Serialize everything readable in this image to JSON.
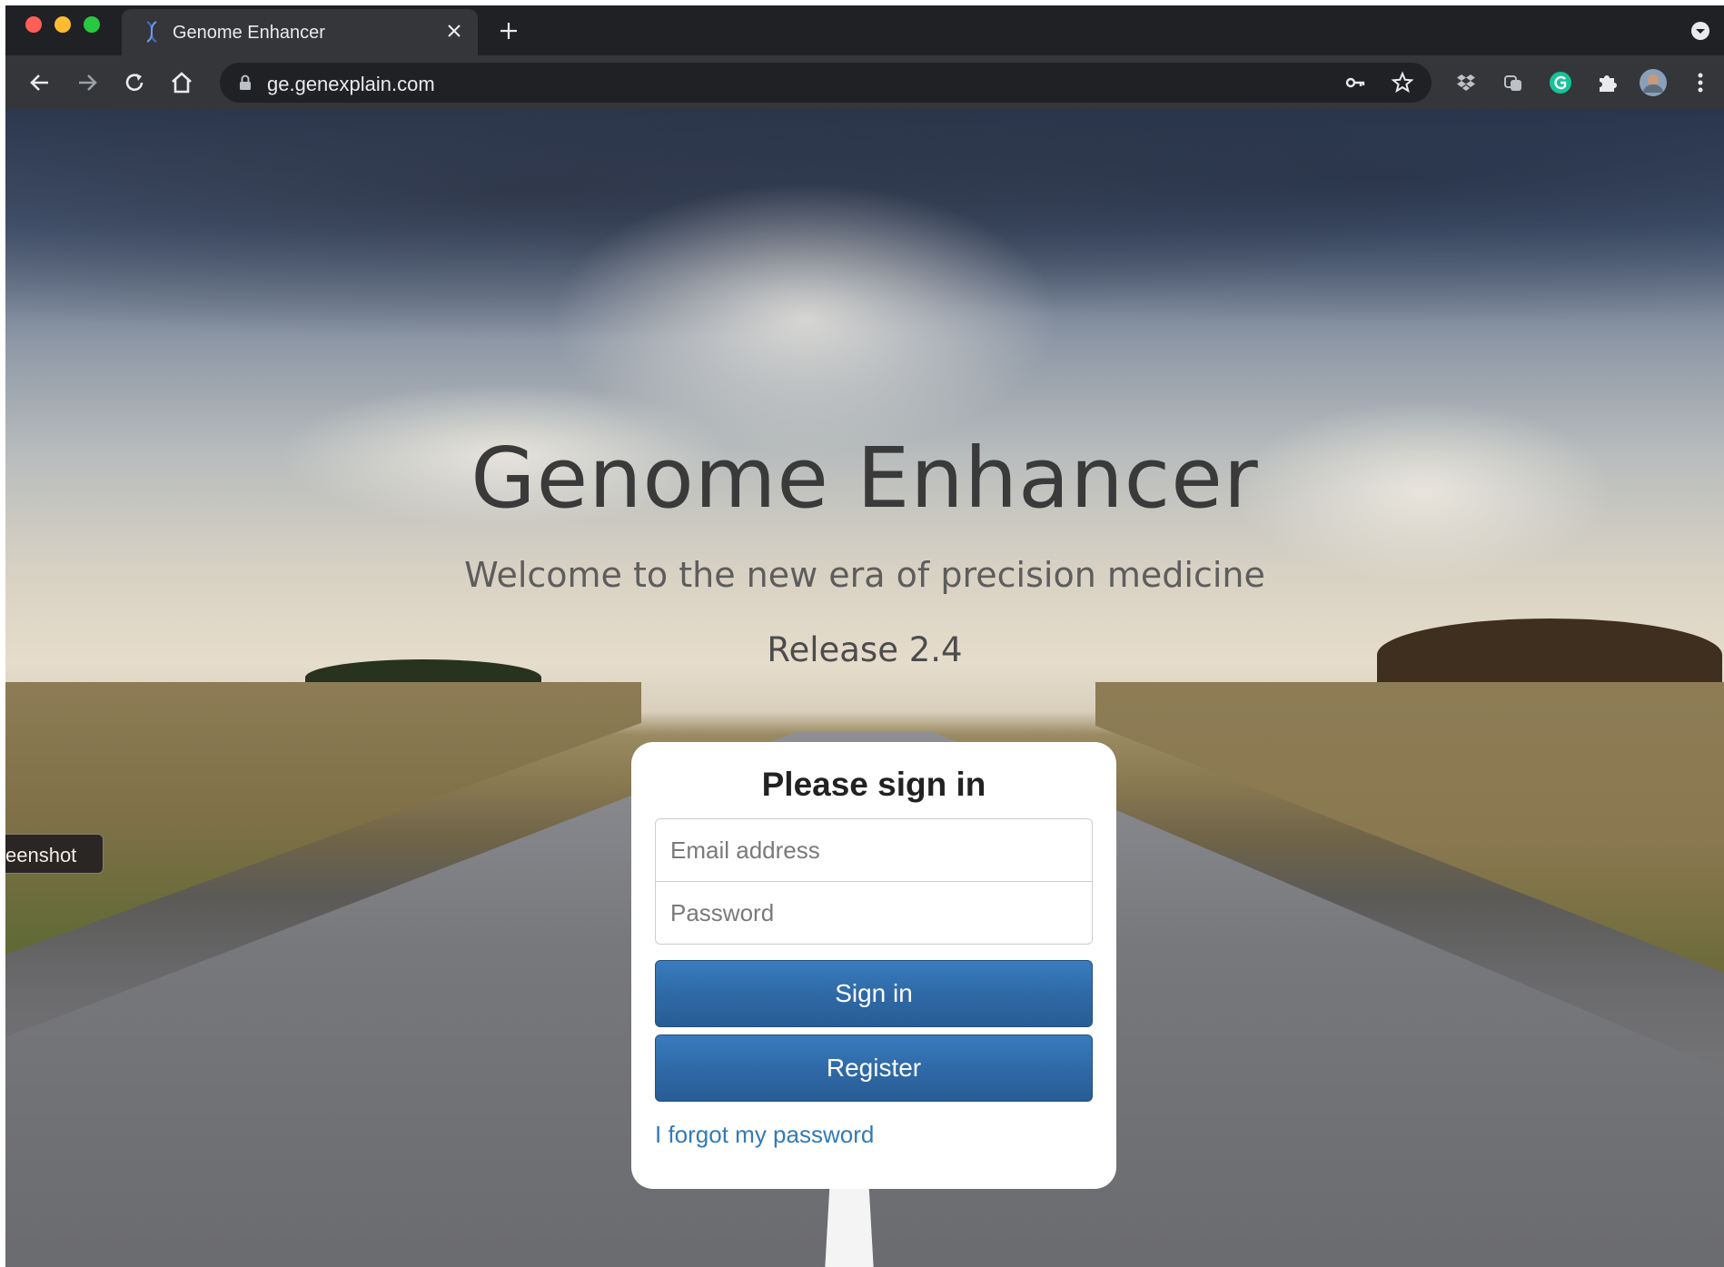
{
  "browser": {
    "tab_title": "Genome Enhancer",
    "url": "ge.genexplain.com",
    "colors": {
      "chrome_dark": "#202124",
      "chrome_toolbar": "#35363a",
      "text": "#e8eaed"
    },
    "icons": {
      "back": "back-arrow-icon",
      "forward": "forward-arrow-icon",
      "reload": "reload-icon",
      "home": "home-icon",
      "lock": "lock-icon",
      "key": "key-icon",
      "bookmark": "star-icon",
      "extensions": [
        "dropbox-icon",
        "copy-icon",
        "grammarly-icon",
        "puzzle-icon"
      ],
      "avatar": "avatar",
      "menu": "kebab-menu-icon"
    }
  },
  "page": {
    "title": "Genome Enhancer",
    "subtitle": "Welcome to the new era of precision medicine",
    "release": "Release 2.4",
    "side_tab": "eenshot"
  },
  "signin": {
    "heading": "Please sign in",
    "email_placeholder": "Email address",
    "password_placeholder": "Password",
    "signin_label": "Sign in",
    "register_label": "Register",
    "forgot_label": "I forgot my password",
    "colors": {
      "button": "#2f6aa7",
      "link": "#337ab7"
    }
  }
}
